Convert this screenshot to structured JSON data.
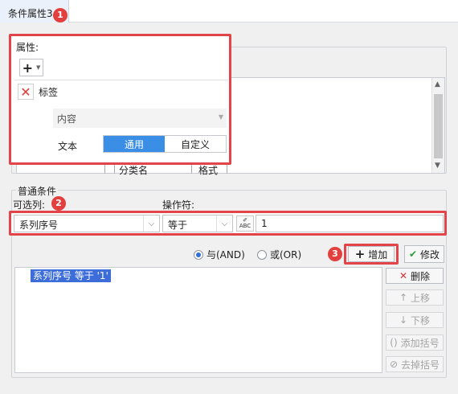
{
  "tab": {
    "title": "条件属性",
    "suffix": "3"
  },
  "badges": [
    "1",
    "2",
    "3"
  ],
  "properties": {
    "label": "属性:",
    "add_symbol": "+",
    "tag_label": "标签",
    "content_select": "内容",
    "text_label": "文本",
    "seg_options": [
      "通用",
      "自定义"
    ],
    "columns": [
      "分类名",
      "格式"
    ]
  },
  "condition": {
    "group_label": "普通条件",
    "column_label": "可选列:",
    "operator_label": "操作符:",
    "column_value": "系列序号",
    "operator_value": "等于",
    "value": "1",
    "formula_icon_text": "ABC"
  },
  "logic": {
    "and_label": "与(AND)",
    "or_label": "或(OR)",
    "selected": "and"
  },
  "actions": {
    "add": "增加",
    "modify": "修改",
    "delete": "删除",
    "up": "上移",
    "down": "下移",
    "add_paren": "添加括号",
    "remove_paren": "去掉括号"
  },
  "conditions_list": [
    "系列序号 等于 '1'"
  ],
  "colors": {
    "accent": "#3a8ee6",
    "highlight": "#e2444a",
    "selection": "#3d6dd8"
  }
}
